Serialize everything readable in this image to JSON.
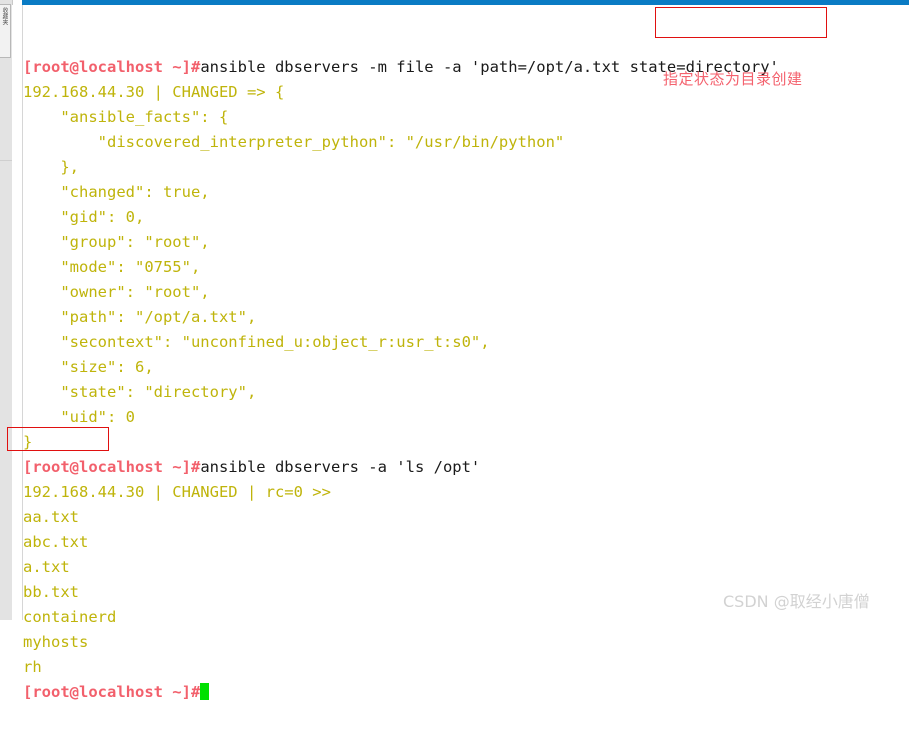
{
  "window": {
    "title_bar_color": "#0a7bc4",
    "background": "#ffffff"
  },
  "left_rail": {
    "tab_label": "收藏夹"
  },
  "colors": {
    "prompt": "#f2606c",
    "command": "#1a1a1a",
    "output_olive": "#bfb40b",
    "highlight_box": "#e01010",
    "annotation": "#f4626e",
    "cursor": "#00e000",
    "watermark": "#d2d2d2"
  },
  "terminal": {
    "lines": [
      {
        "id": "cmd-1",
        "type": "prompt",
        "prompt": "[root@localhost ~]#",
        "command": "ansible dbservers -m file -a 'path=/opt/a.txt state=directory'"
      },
      {
        "id": "out-1",
        "type": "output",
        "text": "192.168.44.30 | CHANGED => {"
      },
      {
        "id": "out-2",
        "type": "output",
        "text": "    \"ansible_facts\": {"
      },
      {
        "id": "out-3",
        "type": "output",
        "text": "        \"discovered_interpreter_python\": \"/usr/bin/python\""
      },
      {
        "id": "out-4",
        "type": "output",
        "text": "    },"
      },
      {
        "id": "out-5",
        "type": "output",
        "text": "    \"changed\": true,"
      },
      {
        "id": "out-6",
        "type": "output",
        "text": "    \"gid\": 0,"
      },
      {
        "id": "out-7",
        "type": "output",
        "text": "    \"group\": \"root\","
      },
      {
        "id": "out-8",
        "type": "output",
        "text": "    \"mode\": \"0755\","
      },
      {
        "id": "out-9",
        "type": "output",
        "text": "    \"owner\": \"root\","
      },
      {
        "id": "out-10",
        "type": "output",
        "text": "    \"path\": \"/opt/a.txt\","
      },
      {
        "id": "out-11",
        "type": "output",
        "text": "    \"secontext\": \"unconfined_u:object_r:usr_t:s0\","
      },
      {
        "id": "out-12",
        "type": "output",
        "text": "    \"size\": 6,"
      },
      {
        "id": "out-13",
        "type": "output",
        "text": "    \"state\": \"directory\","
      },
      {
        "id": "out-14",
        "type": "output",
        "text": "    \"uid\": 0"
      },
      {
        "id": "out-15",
        "type": "output",
        "text": "}"
      },
      {
        "id": "cmd-2",
        "type": "prompt",
        "prompt": "[root@localhost ~]#",
        "command": "ansible dbservers -a 'ls /opt'"
      },
      {
        "id": "out-16",
        "type": "output",
        "text": "192.168.44.30 | CHANGED | rc=0 >>"
      },
      {
        "id": "out-17",
        "type": "output",
        "text": "aa.txt"
      },
      {
        "id": "out-18",
        "type": "output",
        "text": "abc.txt"
      },
      {
        "id": "out-19",
        "type": "output",
        "text": "a.txt"
      },
      {
        "id": "out-20",
        "type": "output",
        "text": "bb.txt"
      },
      {
        "id": "out-21",
        "type": "output",
        "text": "containerd"
      },
      {
        "id": "out-22",
        "type": "output",
        "text": "myhosts"
      },
      {
        "id": "out-23",
        "type": "output",
        "text": "rh"
      },
      {
        "id": "cmd-3",
        "type": "prompt-cursor",
        "prompt": "[root@localhost ~]#",
        "command": ""
      }
    ]
  },
  "annotations": {
    "state_directory_note": "指定状态为目录创建",
    "highlight_state": "state=directory'",
    "highlight_file": "a.txt"
  },
  "watermark": {
    "text": "CSDN @取经小唐僧"
  }
}
